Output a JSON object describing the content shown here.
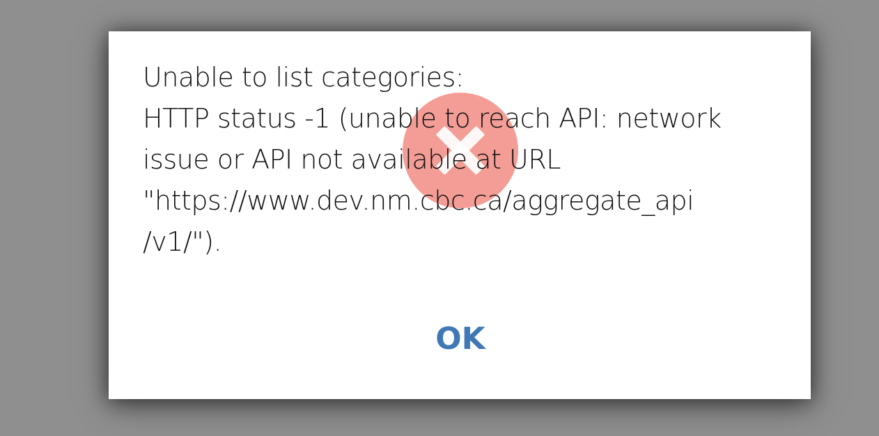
{
  "dialog": {
    "message_lines": [
      "Unable to list categories:",
      "HTTP status -1 (unable to reach API: network",
      "issue or API not available at URL",
      "\"https://www.dev.nm.cbc.ca/aggregate_api",
      "/v1/\")."
    ],
    "ok_label": "OK",
    "icon": "error-x-icon"
  },
  "colors": {
    "backdrop": "#8f8f8f",
    "dialog_bg": "#ffffff",
    "text": "#111111",
    "accent": "#3f78b5",
    "error_icon": "#ef8278"
  }
}
